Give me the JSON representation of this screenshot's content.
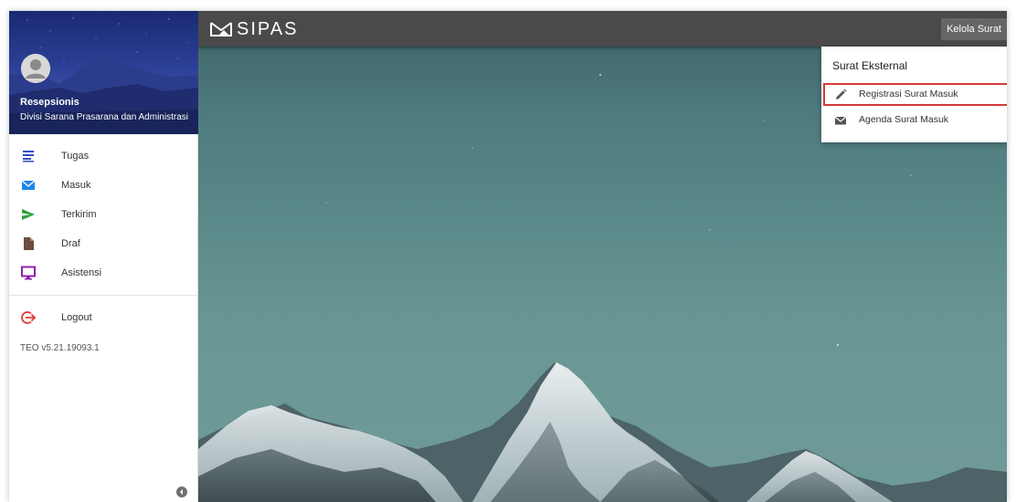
{
  "app": {
    "brand": "SIPAS"
  },
  "profile": {
    "name": "Resepsionis",
    "division": "Divisi Sarana Prasarana dan Administrasi"
  },
  "sidebar": {
    "items": [
      {
        "label": "Tugas",
        "icon": "list-icon",
        "color": "#2c4fbf"
      },
      {
        "label": "Masuk",
        "icon": "mail-icon",
        "color": "#1e88e5"
      },
      {
        "label": "Terkirim",
        "icon": "send-icon",
        "color": "#2e9e3e"
      },
      {
        "label": "Draf",
        "icon": "file-icon",
        "color": "#6d4c41"
      },
      {
        "label": "Asistensi",
        "icon": "monitor-icon",
        "color": "#8e24aa"
      }
    ],
    "logout": {
      "label": "Logout",
      "icon": "logout-icon",
      "color": "#e53935"
    },
    "version": "TEO v5.21.19093.1"
  },
  "topbar": {
    "menu_label": "Kelola Surat"
  },
  "dropdown": {
    "title": "Surat Eksternal",
    "items": [
      {
        "label": "Registrasi Surat Masuk",
        "icon": "pencil-icon"
      },
      {
        "label": "Agenda Surat Masuk",
        "icon": "envelope-icon"
      }
    ]
  }
}
